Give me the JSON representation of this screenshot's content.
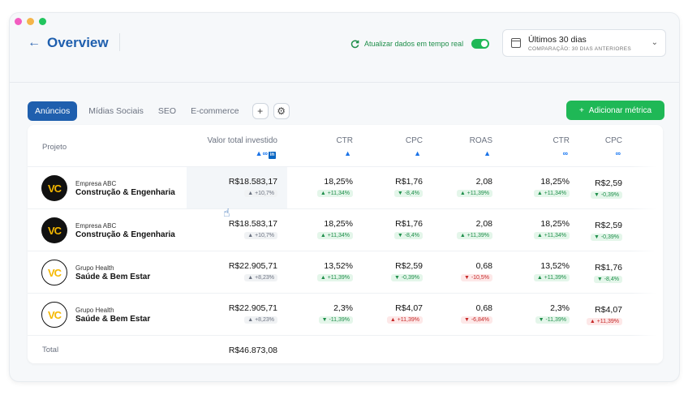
{
  "window": {
    "dots": [
      "#f25cc0",
      "#f5b54a",
      "#22c55e"
    ]
  },
  "header": {
    "title": "Overview",
    "sync_label": "Atualizar dados em tempo real",
    "date_range": "Últimos 30 dias",
    "comparison": "COMPARAÇÃO: 30 DIAS ANTERIORES"
  },
  "tabs": [
    {
      "label": "Anúncios",
      "active": true
    },
    {
      "label": "Mídias Sociais",
      "active": false
    },
    {
      "label": "SEO",
      "active": false
    },
    {
      "label": "E-commerce",
      "active": false
    }
  ],
  "add_metric_label": "Adicionar métrica",
  "table": {
    "project_header": "Projeto",
    "columns": [
      {
        "label": "Valor total investido",
        "platform": "google+meta+linkedin"
      },
      {
        "label": "CTR",
        "platform": "google"
      },
      {
        "label": "CPC",
        "platform": "google"
      },
      {
        "label": "ROAS",
        "platform": "google"
      },
      {
        "label": "CTR",
        "platform": "meta"
      },
      {
        "label": "CPC",
        "platform": "meta"
      }
    ],
    "rows": [
      {
        "company": "Empresa ABC",
        "sector": "Construção & Engenharia",
        "logo": "VC",
        "logo_style": "dark",
        "cells": [
          {
            "value": "R$18.583,17",
            "delta": "+10,7%",
            "trend": "neutral"
          },
          {
            "value": "18,25%",
            "delta": "+11,34%",
            "trend": "up"
          },
          {
            "value": "R$1,76",
            "delta": "-8,4%",
            "trend": "down-good"
          },
          {
            "value": "2,08",
            "delta": "+11,39%",
            "trend": "up"
          },
          {
            "value": "18,25%",
            "delta": "+11,34%",
            "trend": "up"
          },
          {
            "value": "R$2,59",
            "delta": "-0,39%",
            "trend": "down-good"
          }
        ]
      },
      {
        "company": "Empresa ABC",
        "sector": "Construção & Engenharia",
        "logo": "VC",
        "logo_style": "dark",
        "cells": [
          {
            "value": "R$18.583,17",
            "delta": "+10,7%",
            "trend": "neutral"
          },
          {
            "value": "18,25%",
            "delta": "+11,34%",
            "trend": "up"
          },
          {
            "value": "R$1,76",
            "delta": "-8,4%",
            "trend": "down-good"
          },
          {
            "value": "2,08",
            "delta": "+11,39%",
            "trend": "up"
          },
          {
            "value": "18,25%",
            "delta": "+11,34%",
            "trend": "up"
          },
          {
            "value": "R$2,59",
            "delta": "-0,39%",
            "trend": "down-good"
          }
        ]
      },
      {
        "company": "Grupo Health",
        "sector": "Saúde & Bem Estar",
        "logo": "VC",
        "logo_style": "light",
        "cells": [
          {
            "value": "R$22.905,71",
            "delta": "+8,23%",
            "trend": "neutral"
          },
          {
            "value": "13,52%",
            "delta": "+11,39%",
            "trend": "up"
          },
          {
            "value": "R$2,59",
            "delta": "-0,39%",
            "trend": "down-good"
          },
          {
            "value": "0,68",
            "delta": "-10,5%",
            "trend": "down-bad"
          },
          {
            "value": "13,52%",
            "delta": "+11,39%",
            "trend": "up"
          },
          {
            "value": "R$1,76",
            "delta": "-8,4%",
            "trend": "down-good"
          }
        ]
      },
      {
        "company": "Grupo Health",
        "sector": "Saúde & Bem Estar",
        "logo": "VC",
        "logo_style": "light",
        "cells": [
          {
            "value": "R$22.905,71",
            "delta": "+8,23%",
            "trend": "neutral"
          },
          {
            "value": "2,3%",
            "delta": "-11,39%",
            "trend": "down-good"
          },
          {
            "value": "R$4,07",
            "delta": "+11,39%",
            "trend": "up-bad"
          },
          {
            "value": "0,68",
            "delta": "-6,84%",
            "trend": "down-bad"
          },
          {
            "value": "2,3%",
            "delta": "-11,39%",
            "trend": "down-good"
          },
          {
            "value": "R$4,07",
            "delta": "+11,39%",
            "trend": "up-bad"
          }
        ]
      }
    ],
    "total_label": "Total",
    "total_value": "R$46.873,08"
  }
}
